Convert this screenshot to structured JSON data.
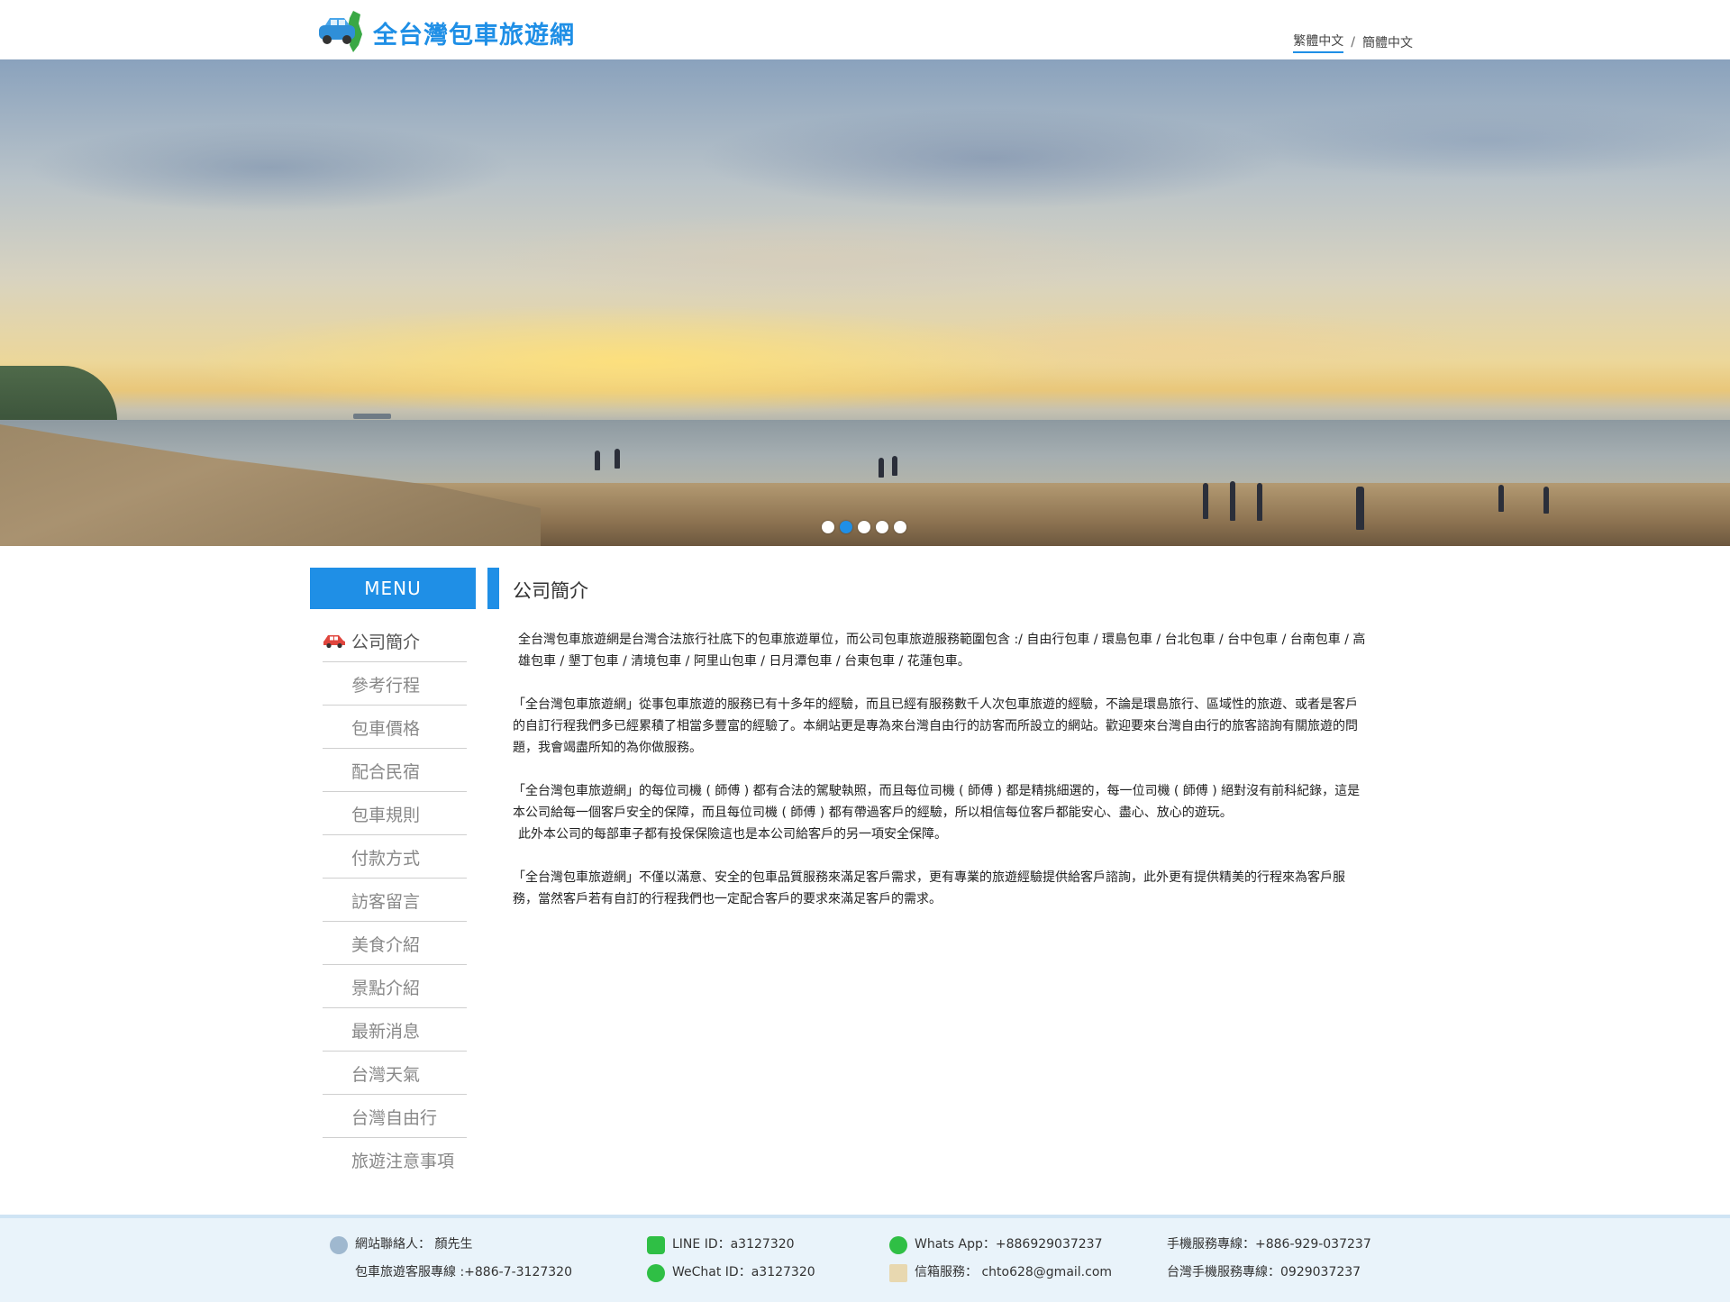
{
  "header": {
    "logo_text": "全台灣包車旅遊網",
    "lang_traditional": "繁體中文",
    "lang_sep": "/",
    "lang_simplified": "簡體中文"
  },
  "hero": {
    "slide_count": 5,
    "active_slide": 2
  },
  "sidebar": {
    "menu_title": "MENU",
    "items": [
      {
        "label": "公司簡介"
      },
      {
        "label": "參考行程"
      },
      {
        "label": "包車價格"
      },
      {
        "label": "配合民宿"
      },
      {
        "label": "包車規則"
      },
      {
        "label": "付款方式"
      },
      {
        "label": "訪客留言"
      },
      {
        "label": "美食介紹"
      },
      {
        "label": "景點介紹"
      },
      {
        "label": "最新消息"
      },
      {
        "label": "台灣天氣"
      },
      {
        "label": "台灣自由行"
      },
      {
        "label": "旅遊注意事項"
      }
    ]
  },
  "main": {
    "title": "公司簡介",
    "paragraphs": [
      "全台灣包車旅遊網是台灣合法旅行社底下的包車旅遊單位，而公司包車旅遊服務範圍包含 :/ 自由行包車 / 環島包車 / 台北包車 / 台中包車 / 台南包車 / 高雄包車 / 墾丁包車 / 清境包車 / 阿里山包車 / 日月潭包車 / 台東包車 / 花蓮包車。",
      "「全台灣包車旅遊網」從事包車旅遊的服務已有十多年的經驗，而且已經有服務數千人次包車旅遊的經驗，不論是環島旅行、區域性的旅遊、或者是客戶的自訂行程我們多已經累積了相當多豐富的經驗了。本網站更是專為來台灣自由行的訪客而所設立的網站。歡迎要來台灣自由行的旅客諮詢有關旅遊的問題，我會竭盡所知的為你做服務。",
      "「全台灣包車旅遊網」的每位司機 ( 師傅 ) 都有合法的駕駛執照，而且每位司機 ( 師傅 ) 都是精挑細選的，每一位司機 ( 師傅 ) 絕對沒有前科紀錄，這是本公司給每一個客戶安全的保障，而且每位司機 ( 師傅 ) 都有帶過客戶的經驗，所以相信每位客戶都能安心、盡心、放心的遊玩。",
      "此外本公司的每部車子都有投保保險這也是本公司給客戶的另一項安全保障。",
      " 「全台灣包車旅遊網」不僅以滿意、安全的包車品質服務來滿足客戶需求，更有專業的旅遊經驗提供給客戶諮詢，此外更有提供精美的行程來為客戶服務，當然客戶若有自訂的行程我們也一定配合客戶的要求來滿足客戶的需求。"
    ]
  },
  "footer": {
    "contact_person": "網站聯絡人： 顏先生",
    "service_line": "包車旅遊客服專線 :+886-7-3127320",
    "line_id": "LINE ID：a3127320",
    "wechat_id": "WeChat ID：a3127320",
    "whatsapp": "Whats App：+886929037237",
    "email": "信箱服務： chto628@gmail.com",
    "mobile_line": "手機服務專線：+886-929-037237",
    "tw_mobile_line": "台灣手機服務專線：0929037237"
  },
  "colors": {
    "accent": "#1f8fe6",
    "footer_bg": "#e9f3fa"
  }
}
